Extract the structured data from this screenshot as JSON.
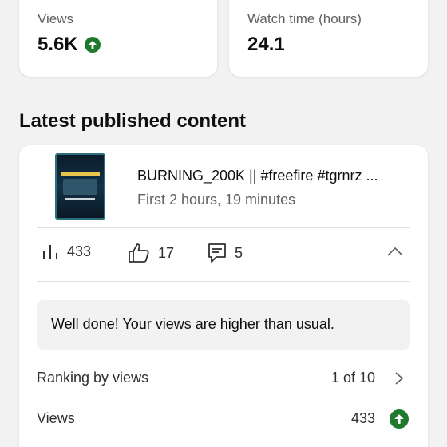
{
  "stats": [
    {
      "label": "Views",
      "value": "5.6K",
      "trend": "up"
    },
    {
      "label": "Watch time (hours)",
      "value": "24.1"
    }
  ],
  "section_title": "Latest published content",
  "video": {
    "thumbnail_icon": "video-thumbnail",
    "title": "BURNING_200K || #freefire #tgrnrz ...",
    "subtitle": "First 2 hours, 19 minutes"
  },
  "metrics": {
    "views": "433",
    "likes": "17",
    "comments": "5"
  },
  "notice": "Well done! Your views are higher than usual.",
  "ranking": {
    "label": "Ranking by views",
    "value": "1 of 10"
  },
  "views_row": {
    "label": "Views",
    "value": "433",
    "trend": "up"
  },
  "colors": {
    "trend_up": "#1f7a2d",
    "background": "#f2f2f2",
    "card": "#ffffff"
  }
}
